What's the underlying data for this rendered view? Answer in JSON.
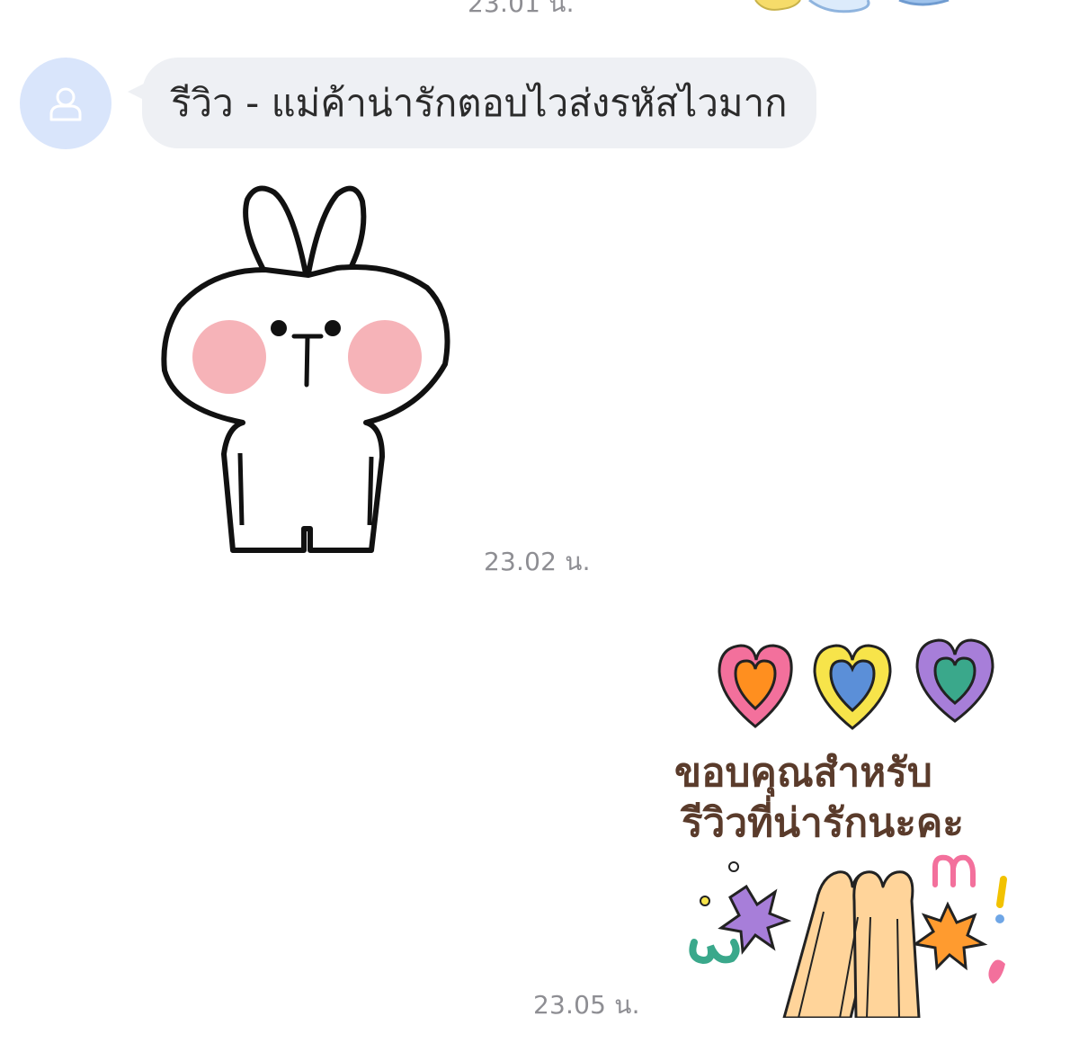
{
  "chat": {
    "timestamp_top": "23.01 น.",
    "message": {
      "text": "รีวิว - แม่ค้าน่ารักตอบไวส่งรหัสไวมาก"
    },
    "sticker_rabbit": {
      "timestamp": "23.02 น."
    },
    "sticker_thanks": {
      "line1": "ขอบคุณสำหรับ",
      "line2": "รีวิวที่น่ารักนะคะ",
      "timestamp": "23.05 น."
    }
  },
  "colors": {
    "avatar_bg": "#d9e5fb",
    "bubble_bg": "#eef0f4",
    "timestamp": "#8e8e93",
    "cheek": "#f6b3b8",
    "heart_pink": "#f3709c",
    "heart_yellow": "#f7e44a",
    "heart_purple": "#a77ed9"
  }
}
